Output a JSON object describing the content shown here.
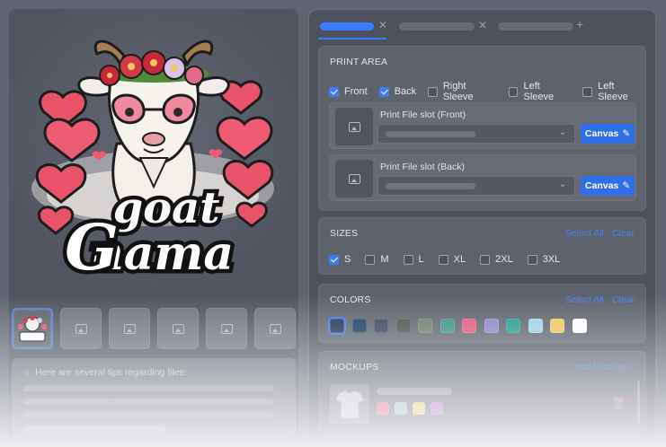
{
  "tips": {
    "title": "Here are several tips regarding files:"
  },
  "print_area": {
    "title": "PRINT AREA",
    "options": [
      {
        "label": "Front",
        "checked": true
      },
      {
        "label": "Back",
        "checked": true
      },
      {
        "label": "Right Sleeve",
        "checked": false
      },
      {
        "label": "Left Sleeve",
        "checked": false
      },
      {
        "label": "Left Sleeve",
        "checked": false
      }
    ],
    "slots": [
      {
        "label": "Print File slot (Front)",
        "button": "Canvas"
      },
      {
        "label": "Print File slot (Back)",
        "button": "Canvas"
      }
    ]
  },
  "sizes": {
    "title": "SIZES",
    "select_all": "Select All",
    "clear": "Clear",
    "options": [
      {
        "label": "S",
        "checked": true
      },
      {
        "label": "M",
        "checked": false
      },
      {
        "label": "L",
        "checked": false
      },
      {
        "label": "XL",
        "checked": false
      },
      {
        "label": "2XL",
        "checked": false
      },
      {
        "label": "3XL",
        "checked": false
      }
    ]
  },
  "colors": {
    "title": "COLORS",
    "select_all": "Select All",
    "clear": "Clear",
    "swatches": [
      "#1f2f52",
      "#153a5a",
      "#363f5c",
      "#4b4d4a",
      "#6d7a6c",
      "#3a8f85",
      "#e0567a",
      "#8a86c9",
      "#1f9b8d",
      "#9fd3ea",
      "#f3c660",
      "#ffffff"
    ],
    "selected_index": 0
  },
  "mockups": {
    "title": "MOCKUPS",
    "add_label": "Add Mockup +",
    "mini_swatches": [
      "#e0567a",
      "#9fb0c8",
      "#f3c660",
      "#b066c9"
    ]
  },
  "design": {
    "line1": "goat",
    "line2": "nama",
    "colors": {
      "heart": "#e8536a",
      "flower": "#c8283a",
      "glasses": "#f08aa0"
    }
  }
}
